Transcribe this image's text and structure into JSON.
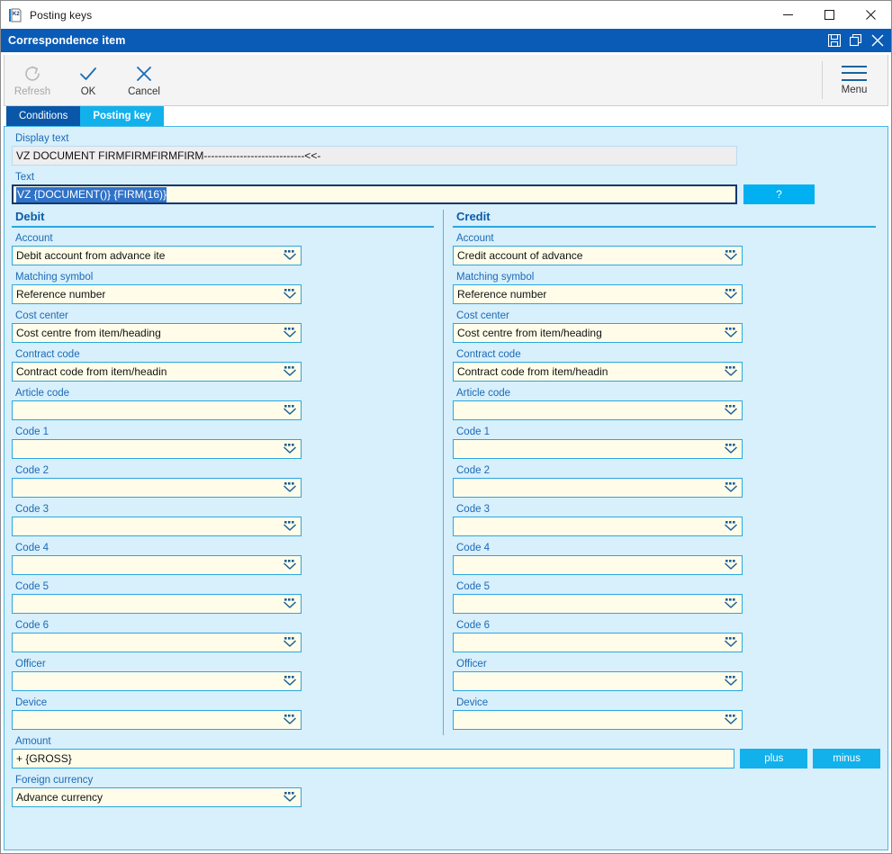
{
  "window": {
    "title": "Posting keys",
    "app_icon": "k2-logo-icon",
    "controls": {
      "minimize": "minimize-icon",
      "maximize": "maximize-icon",
      "close": "close-icon"
    }
  },
  "header": {
    "title": "Correspondence item",
    "buttons": {
      "save": "save-icon",
      "restore": "restore-icon",
      "close": "close-icon"
    },
    "background_color": "#0a5bb5"
  },
  "ribbon": {
    "buttons": [
      {
        "label": "Refresh",
        "icon": "refresh-icon",
        "disabled": true
      },
      {
        "label": "OK",
        "icon": "check-icon",
        "disabled": false
      },
      {
        "label": "Cancel",
        "icon": "cross-icon",
        "disabled": false
      }
    ],
    "menu": {
      "label": "Menu",
      "icon": "hamburger-icon"
    }
  },
  "tabs": [
    {
      "label": "Conditions",
      "active": false
    },
    {
      "label": "Posting key",
      "active": true
    }
  ],
  "top_fields": {
    "display_text": {
      "label": "Display text",
      "value": "VZ DOCUMENT FIRMFIRMFIRMFIRM----------------------------<<-",
      "readonly": true
    },
    "text": {
      "label": "Text",
      "value": "VZ {DOCUMENT()} {FIRM(16)}",
      "focused": true,
      "selected": true
    },
    "help_button": {
      "label": "?"
    }
  },
  "debit": {
    "heading": "Debit",
    "fields": [
      {
        "label": "Account",
        "value": "Debit account from advance ite"
      },
      {
        "label": "Matching symbol",
        "value": "Reference number"
      },
      {
        "label": "Cost center",
        "value": "Cost centre from item/heading"
      },
      {
        "label": "Contract code",
        "value": "Contract code from item/headin"
      },
      {
        "label": "Article code",
        "value": ""
      },
      {
        "label": "Code 1",
        "value": ""
      },
      {
        "label": "Code 2",
        "value": ""
      },
      {
        "label": "Code 3",
        "value": ""
      },
      {
        "label": "Code 4",
        "value": ""
      },
      {
        "label": "Code 5",
        "value": ""
      },
      {
        "label": "Code 6",
        "value": ""
      },
      {
        "label": "Officer",
        "value": ""
      },
      {
        "label": "Device",
        "value": ""
      }
    ]
  },
  "credit": {
    "heading": "Credit",
    "fields": [
      {
        "label": "Account",
        "value": "Credit account of advance"
      },
      {
        "label": "Matching symbol",
        "value": "Reference number"
      },
      {
        "label": "Cost center",
        "value": "Cost centre from item/heading"
      },
      {
        "label": "Contract code",
        "value": "Contract code from item/headin"
      },
      {
        "label": "Article code",
        "value": ""
      },
      {
        "label": "Code 1",
        "value": ""
      },
      {
        "label": "Code 2",
        "value": ""
      },
      {
        "label": "Code 3",
        "value": ""
      },
      {
        "label": "Code 4",
        "value": ""
      },
      {
        "label": "Code 5",
        "value": ""
      },
      {
        "label": "Code 6",
        "value": ""
      },
      {
        "label": "Officer",
        "value": ""
      },
      {
        "label": "Device",
        "value": ""
      }
    ]
  },
  "bottom": {
    "amount": {
      "label": "Amount",
      "value": "+ {GROSS}"
    },
    "plus_button": "plus",
    "minus_button": "minus",
    "foreign_currency": {
      "label": "Foreign currency",
      "value": "Advance currency"
    }
  },
  "colors": {
    "header_blue": "#0a5bb5",
    "accent_cyan": "#12b1ec",
    "field_bg": "#fffdea",
    "form_bg": "#d8effc",
    "label_blue": "#1b6bb5",
    "selection_blue": "#2f72c8"
  }
}
